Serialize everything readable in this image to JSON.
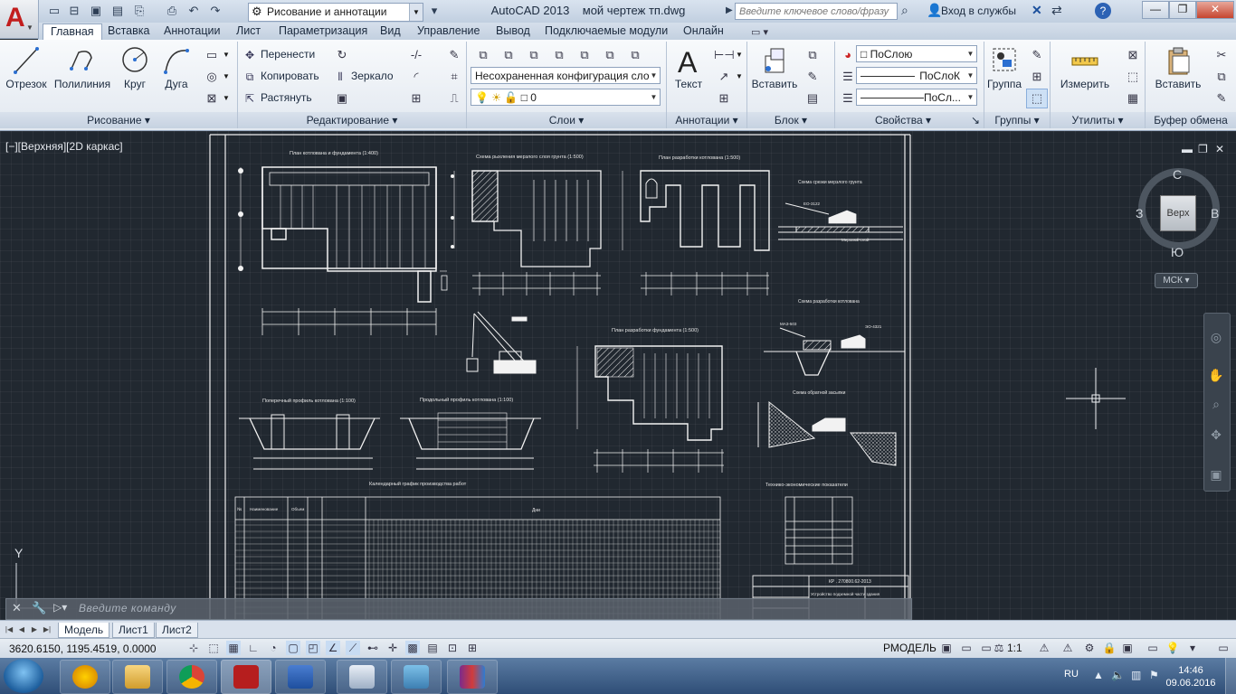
{
  "window": {
    "app_title": "AutoCAD 2013",
    "document_title": "мой чертеж тп.dwg",
    "workspace": "Рисование и аннотации",
    "search_placeholder": "Введите ключевое слово/фразу",
    "login_label": "Вход в службы"
  },
  "tabs": [
    "Главная",
    "Вставка",
    "Аннотации",
    "Лист",
    "Параметризация",
    "Вид",
    "Управление",
    "Вывод",
    "Подключаемые модули",
    "Онлайн"
  ],
  "ribbon": {
    "draw": {
      "panel": "Рисование",
      "line": "Отрезок",
      "polyline": "Полилиния",
      "circle": "Круг",
      "arc": "Дуга"
    },
    "modify": {
      "panel": "Редактирование",
      "move": "Перенести",
      "copy": "Копировать",
      "stretch": "Растянуть",
      "mirror": "Зеркало"
    },
    "layers": {
      "panel": "Слои",
      "state": "Несохраненная конфигурация сло",
      "current": "0"
    },
    "annotation": {
      "panel": "Аннотации",
      "text": "Текст"
    },
    "block": {
      "panel": "Блок",
      "insert": "Вставить"
    },
    "properties": {
      "panel": "Свойства",
      "color": "ПоСлою",
      "linetype": "ПоСлоК",
      "lineweight": "ПоСл..."
    },
    "groups": {
      "panel": "Группы",
      "group": "Группа"
    },
    "utilities": {
      "panel": "Утилиты",
      "measure": "Измерить"
    },
    "clipboard": {
      "panel": "Буфер обмена",
      "paste": "Вставить"
    }
  },
  "viewport": {
    "label": "[−][Верхняя][2D каркас]",
    "viewcube": {
      "face": "Верх",
      "north": "С",
      "south": "Ю",
      "west": "З",
      "east": "В"
    },
    "ucs_menu": "МСК",
    "y_axis": "Y"
  },
  "drawing": {
    "t1": "План котлована и фундамента (1:400)",
    "t2": "Схема рыхления мерзлого слоя грунта (1:500)",
    "t3": "План разработки котлована (1:500)",
    "t4": "Схема срезки мерзлого грунта",
    "t4b": "Мерзлый слой",
    "t5": "Схема разработки котлована",
    "t6": "План разработки фундамента (1:500)",
    "t7": "Схема обратной засыпки",
    "t8": "Поперечный профиль котлована (1:100)",
    "t9": "Продольный профиль котлована (1:100)",
    "t10": "Календарный график производства работ",
    "t11": "Технико-экономические показатели",
    "table_head": {
      "num": "№",
      "name": "Наименование",
      "vol": "Объем",
      "days": "Дни"
    },
    "stamp_code": "КР . 270800.62-2013",
    "stamp_text": "Устройство подземной части здания",
    "labels": {
      "a": "ЕО-3122",
      "b": "ЭО-4321",
      "c": "МАЗ-503"
    }
  },
  "command_placeholder": "Введите  команду",
  "layout_tabs": [
    "Модель",
    "Лист1",
    "Лист2"
  ],
  "status": {
    "coords": "3620.6150, 1195.4519, 0.0000",
    "space": "РМОДЕЛЬ",
    "scale": "1:1"
  },
  "taskbar": {
    "lang": "RU",
    "time": "14:46",
    "date": "09.06.2016"
  }
}
